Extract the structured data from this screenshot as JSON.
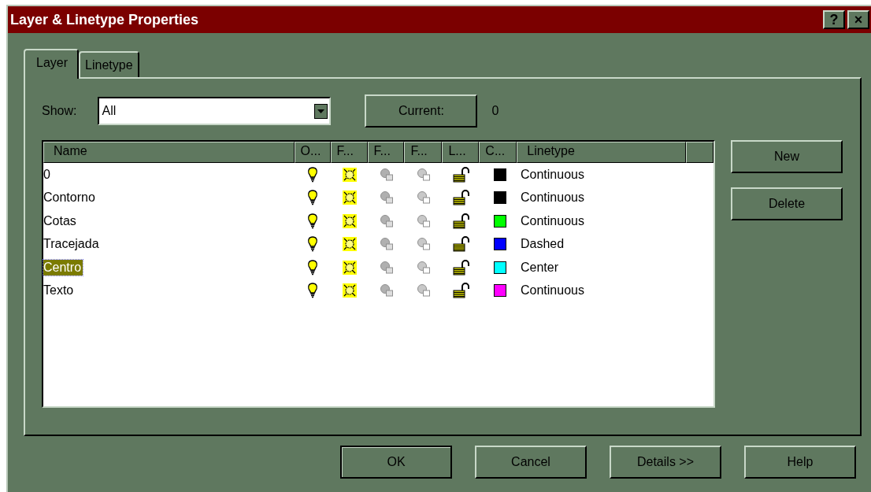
{
  "window": {
    "title": "Layer & Linetype Properties",
    "title_buttons": [
      "?",
      "×"
    ]
  },
  "tabs": [
    {
      "label": "Layer",
      "selected": true
    },
    {
      "label": "Linetype",
      "selected": false
    }
  ],
  "show": {
    "label": "Show:",
    "value": "All"
  },
  "current": {
    "button": "Current:",
    "value": "0"
  },
  "table": {
    "columns": [
      "Name",
      "O...",
      "F...",
      "F...",
      "F...",
      "L...",
      "C...",
      "Linetype",
      ""
    ],
    "rows": [
      {
        "name": "0",
        "on": true,
        "frozen": false,
        "locked": false,
        "color": "#000000",
        "linetype": "Continuous",
        "selected": false
      },
      {
        "name": "Contorno",
        "on": true,
        "frozen": false,
        "locked": false,
        "color": "#000000",
        "linetype": "Continuous",
        "selected": false
      },
      {
        "name": "Cotas",
        "on": true,
        "frozen": false,
        "locked": false,
        "color": "#00ff00",
        "linetype": "Continuous",
        "selected": false
      },
      {
        "name": "Tracejada",
        "on": true,
        "frozen": false,
        "locked": false,
        "color": "#0000ff",
        "linetype": "Dashed",
        "selected": false
      },
      {
        "name": "Centro",
        "on": true,
        "frozen": false,
        "locked": false,
        "color": "#00ffff",
        "linetype": "Center",
        "selected": true
      },
      {
        "name": "Texto",
        "on": true,
        "frozen": false,
        "locked": false,
        "color": "#ff00ff",
        "linetype": "Continuous",
        "selected": false
      }
    ]
  },
  "side_buttons": [
    "New",
    "Delete"
  ],
  "buttons": [
    "OK",
    "Cancel",
    "Details >>",
    "Help"
  ]
}
